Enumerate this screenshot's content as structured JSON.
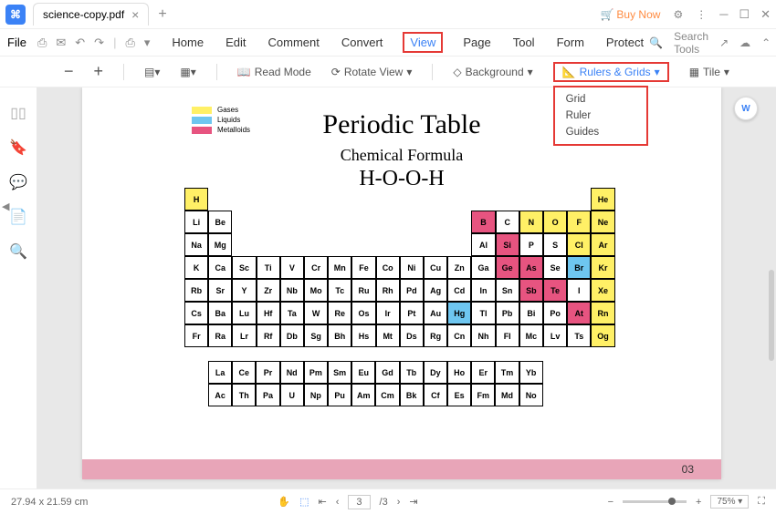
{
  "titlebar": {
    "tab_name": "science-copy.pdf",
    "buy_now": "Buy Now"
  },
  "menubar": {
    "file": "File",
    "tabs": [
      "Home",
      "Edit",
      "Comment",
      "Convert",
      "View",
      "Page",
      "Tool",
      "Form",
      "Protect"
    ],
    "active_tab": "View",
    "search_placeholder": "Search Tools"
  },
  "toolbar": {
    "read_mode": "Read Mode",
    "rotate_view": "Rotate View",
    "background": "Background",
    "rulers_grids": "Rulers & Grids",
    "tile": "Tile",
    "dropdown": [
      "Grid",
      "Ruler",
      "Guides"
    ]
  },
  "legend": {
    "gases": "Gases",
    "liquids": "Liquids",
    "metalloids": "Metalloids"
  },
  "doc": {
    "title": "Periodic Table",
    "subtitle": "Chemical Formula",
    "formula": "H-O-O-H",
    "page_num": "03"
  },
  "statusbar": {
    "dims": "27.94 x 21.59 cm",
    "page_current": "3",
    "page_total": "/3",
    "zoom": "75%"
  },
  "chart_data": {
    "type": "table",
    "title": "Periodic Table",
    "legend": {
      "yellow": "Gases",
      "blue": "Liquids",
      "pink": "Metalloids"
    },
    "main_grid_rows": 7,
    "main_grid_cols": 18,
    "elements": [
      {
        "sym": "H",
        "row": 0,
        "col": 0,
        "cat": "yellow"
      },
      {
        "sym": "He",
        "row": 0,
        "col": 17,
        "cat": "yellow"
      },
      {
        "sym": "Li",
        "row": 1,
        "col": 0
      },
      {
        "sym": "Be",
        "row": 1,
        "col": 1
      },
      {
        "sym": "B",
        "row": 1,
        "col": 12,
        "cat": "pink"
      },
      {
        "sym": "C",
        "row": 1,
        "col": 13
      },
      {
        "sym": "N",
        "row": 1,
        "col": 14,
        "cat": "yellow"
      },
      {
        "sym": "O",
        "row": 1,
        "col": 15,
        "cat": "yellow"
      },
      {
        "sym": "F",
        "row": 1,
        "col": 16,
        "cat": "yellow"
      },
      {
        "sym": "Ne",
        "row": 1,
        "col": 17,
        "cat": "yellow"
      },
      {
        "sym": "Na",
        "row": 2,
        "col": 0
      },
      {
        "sym": "Mg",
        "row": 2,
        "col": 1
      },
      {
        "sym": "Al",
        "row": 2,
        "col": 12
      },
      {
        "sym": "Si",
        "row": 2,
        "col": 13,
        "cat": "pink"
      },
      {
        "sym": "P",
        "row": 2,
        "col": 14
      },
      {
        "sym": "S",
        "row": 2,
        "col": 15
      },
      {
        "sym": "Cl",
        "row": 2,
        "col": 16,
        "cat": "yellow"
      },
      {
        "sym": "Ar",
        "row": 2,
        "col": 17,
        "cat": "yellow"
      },
      {
        "sym": "K",
        "row": 3,
        "col": 0
      },
      {
        "sym": "Ca",
        "row": 3,
        "col": 1
      },
      {
        "sym": "Sc",
        "row": 3,
        "col": 2
      },
      {
        "sym": "Ti",
        "row": 3,
        "col": 3
      },
      {
        "sym": "V",
        "row": 3,
        "col": 4
      },
      {
        "sym": "Cr",
        "row": 3,
        "col": 5
      },
      {
        "sym": "Mn",
        "row": 3,
        "col": 6
      },
      {
        "sym": "Fe",
        "row": 3,
        "col": 7
      },
      {
        "sym": "Co",
        "row": 3,
        "col": 8
      },
      {
        "sym": "Ni",
        "row": 3,
        "col": 9
      },
      {
        "sym": "Cu",
        "row": 3,
        "col": 10
      },
      {
        "sym": "Zn",
        "row": 3,
        "col": 11
      },
      {
        "sym": "Ga",
        "row": 3,
        "col": 12
      },
      {
        "sym": "Ge",
        "row": 3,
        "col": 13,
        "cat": "pink"
      },
      {
        "sym": "As",
        "row": 3,
        "col": 14,
        "cat": "pink"
      },
      {
        "sym": "Se",
        "row": 3,
        "col": 15
      },
      {
        "sym": "Br",
        "row": 3,
        "col": 16,
        "cat": "blue"
      },
      {
        "sym": "Kr",
        "row": 3,
        "col": 17,
        "cat": "yellow"
      },
      {
        "sym": "Rb",
        "row": 4,
        "col": 0
      },
      {
        "sym": "Sr",
        "row": 4,
        "col": 1
      },
      {
        "sym": "Y",
        "row": 4,
        "col": 2
      },
      {
        "sym": "Zr",
        "row": 4,
        "col": 3
      },
      {
        "sym": "Nb",
        "row": 4,
        "col": 4
      },
      {
        "sym": "Mo",
        "row": 4,
        "col": 5
      },
      {
        "sym": "Tc",
        "row": 4,
        "col": 6
      },
      {
        "sym": "Ru",
        "row": 4,
        "col": 7
      },
      {
        "sym": "Rh",
        "row": 4,
        "col": 8
      },
      {
        "sym": "Pd",
        "row": 4,
        "col": 9
      },
      {
        "sym": "Ag",
        "row": 4,
        "col": 10
      },
      {
        "sym": "Cd",
        "row": 4,
        "col": 11
      },
      {
        "sym": "In",
        "row": 4,
        "col": 12
      },
      {
        "sym": "Sn",
        "row": 4,
        "col": 13
      },
      {
        "sym": "Sb",
        "row": 4,
        "col": 14,
        "cat": "pink"
      },
      {
        "sym": "Te",
        "row": 4,
        "col": 15,
        "cat": "pink"
      },
      {
        "sym": "I",
        "row": 4,
        "col": 16
      },
      {
        "sym": "Xe",
        "row": 4,
        "col": 17,
        "cat": "yellow"
      },
      {
        "sym": "Cs",
        "row": 5,
        "col": 0
      },
      {
        "sym": "Ba",
        "row": 5,
        "col": 1
      },
      {
        "sym": "Lu",
        "row": 5,
        "col": 2
      },
      {
        "sym": "Hf",
        "row": 5,
        "col": 3
      },
      {
        "sym": "Ta",
        "row": 5,
        "col": 4
      },
      {
        "sym": "W",
        "row": 5,
        "col": 5
      },
      {
        "sym": "Re",
        "row": 5,
        "col": 6
      },
      {
        "sym": "Os",
        "row": 5,
        "col": 7
      },
      {
        "sym": "Ir",
        "row": 5,
        "col": 8
      },
      {
        "sym": "Pt",
        "row": 5,
        "col": 9
      },
      {
        "sym": "Au",
        "row": 5,
        "col": 10
      },
      {
        "sym": "Hg",
        "row": 5,
        "col": 11,
        "cat": "blue"
      },
      {
        "sym": "Tl",
        "row": 5,
        "col": 12
      },
      {
        "sym": "Pb",
        "row": 5,
        "col": 13
      },
      {
        "sym": "Bi",
        "row": 5,
        "col": 14
      },
      {
        "sym": "Po",
        "row": 5,
        "col": 15
      },
      {
        "sym": "At",
        "row": 5,
        "col": 16,
        "cat": "pink"
      },
      {
        "sym": "Rn",
        "row": 5,
        "col": 17,
        "cat": "yellow"
      },
      {
        "sym": "Fr",
        "row": 6,
        "col": 0
      },
      {
        "sym": "Ra",
        "row": 6,
        "col": 1
      },
      {
        "sym": "Lr",
        "row": 6,
        "col": 2
      },
      {
        "sym": "Rf",
        "row": 6,
        "col": 3
      },
      {
        "sym": "Db",
        "row": 6,
        "col": 4
      },
      {
        "sym": "Sg",
        "row": 6,
        "col": 5
      },
      {
        "sym": "Bh",
        "row": 6,
        "col": 6
      },
      {
        "sym": "Hs",
        "row": 6,
        "col": 7
      },
      {
        "sym": "Mt",
        "row": 6,
        "col": 8
      },
      {
        "sym": "Ds",
        "row": 6,
        "col": 9
      },
      {
        "sym": "Rg",
        "row": 6,
        "col": 10
      },
      {
        "sym": "Cn",
        "row": 6,
        "col": 11
      },
      {
        "sym": "Nh",
        "row": 6,
        "col": 12
      },
      {
        "sym": "Fl",
        "row": 6,
        "col": 13
      },
      {
        "sym": "Mc",
        "row": 6,
        "col": 14
      },
      {
        "sym": "Lv",
        "row": 6,
        "col": 15
      },
      {
        "sym": "Ts",
        "row": 6,
        "col": 16
      },
      {
        "sym": "Og",
        "row": 6,
        "col": 17,
        "cat": "yellow"
      }
    ],
    "lanthanides": [
      [
        "La",
        "Ce",
        "Pr",
        "Nd",
        "Pm",
        "Sm",
        "Eu",
        "Gd",
        "Tb",
        "Dy",
        "Ho",
        "Er",
        "Tm",
        "Yb"
      ],
      [
        "Ac",
        "Th",
        "Pa",
        "U",
        "Np",
        "Pu",
        "Am",
        "Cm",
        "Bk",
        "Cf",
        "Es",
        "Fm",
        "Md",
        "No"
      ]
    ]
  }
}
